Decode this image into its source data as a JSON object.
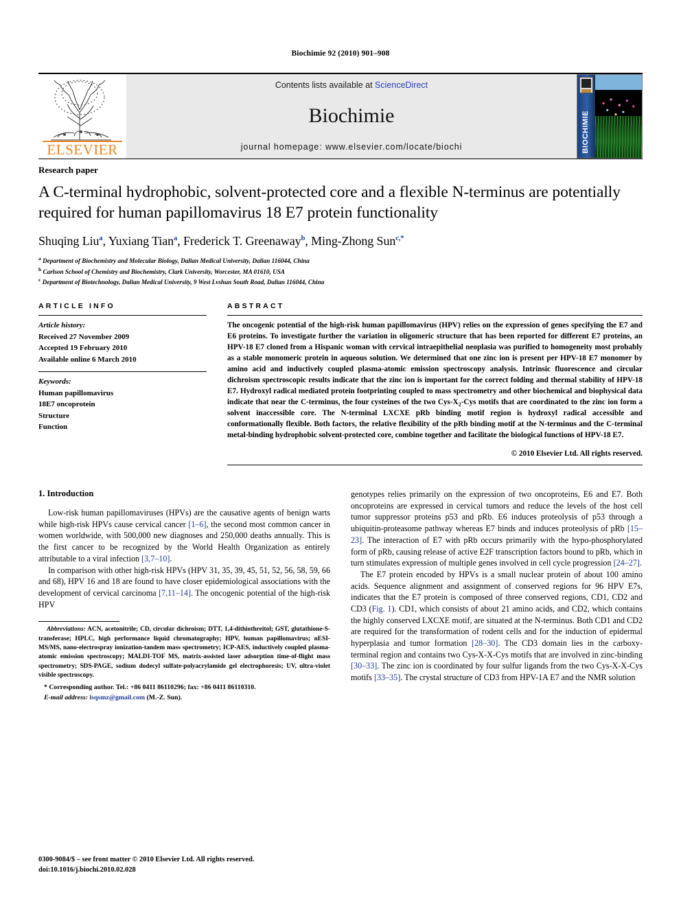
{
  "running_head": "Biochimie 92 (2010) 901–908",
  "masthead": {
    "publisher_name": "ELSEVIER",
    "contents_prefix": "Contents lists available at ",
    "contents_link": "ScienceDirect",
    "journal_title": "Biochimie",
    "homepage": "journal homepage: www.elsevier.com/locate/biochi",
    "cover_spine_text": "BIOCHIMIE",
    "link_color": "#2b3fb0",
    "brand_color": "#f0841e"
  },
  "article": {
    "paper_type": "Research paper",
    "title": "A C-terminal hydrophobic, solvent-protected core and a flexible N-terminus are potentially required for human papillomavirus 18 E7 protein functionality",
    "authors": [
      {
        "name": "Shuqing Liu",
        "sup": "a",
        "sep": ", "
      },
      {
        "name": "Yuxiang Tian",
        "sup": "a",
        "sep": ", "
      },
      {
        "name": "Frederick T. Greenaway",
        "sup": "b",
        "sep": ", "
      },
      {
        "name": "Ming-Zhong Sun",
        "sup": "c,*",
        "sep": ""
      }
    ],
    "affiliations": [
      {
        "mark": "a",
        "text": "Department of Biochemistry and Molecular Biology, Dalian Medical University, Dalian 116044, China"
      },
      {
        "mark": "b",
        "text": "Carlson School of Chemistry and Biochemistry, Clark University, Worcester, MA 01610, USA"
      },
      {
        "mark": "c",
        "text": "Department of Biotechnology, Dalian Medical University, 9 West Lvshun South Road, Dalian 116044, China"
      }
    ]
  },
  "article_info": {
    "heading": "ARTICLE INFO",
    "history_label": "Article history:",
    "history": [
      "Received 27 November 2009",
      "Accepted 19 February 2010",
      "Available online 6 March 2010"
    ],
    "keywords_label": "Keywords:",
    "keywords": [
      "Human papillomavirus",
      "18E7 oncoprotein",
      "Structure",
      "Function"
    ]
  },
  "abstract": {
    "heading": "ABSTRACT",
    "part1": "The oncogenic potential of the high-risk human papillomavirus (HPV) relies on the expression of genes specifying the E7 and E6 proteins. To investigate further the variation in oligomeric structure that has been reported for different E7 proteins, an HPV-18 E7 cloned from a Hispanic woman with cervical intraepithelial neoplasia was purified to homogeneity most probably as a stable monomeric protein in aqueous solution. We determined that one zinc ion is present per HPV-18 E7 monomer by amino acid and inductively coupled plasma-atomic emission spectroscopy analysis. Intrinsic fluorescence and circular dichroism spectroscopic results indicate that the zinc ion is important for the correct folding and thermal stability of HPV-18 E7. Hydroxyl radical mediated protein footprinting coupled to mass spectrometry and other biochemical and biophysical data indicate that near the C-terminus, the four cysteines of the two Cys-X",
    "sub1": "2",
    "part2": "-Cys motifs that are coordinated to the zinc ion form a solvent inaccessible core. The N-terminal LXCXE pRb binding motif region is hydroxyl radical accessible and conformationally flexible. Both factors, the relative flexibility of the pRb binding motif at the N-terminus and the C-terminal metal-binding hydrophobic solvent-protected core, combine together and facilitate the biological functions of HPV-18 E7.",
    "copyright": "© 2010 Elsevier Ltd. All rights reserved."
  },
  "intro": {
    "heading": "1. Introduction",
    "left": {
      "p1_a": "Low-risk human papillomaviruses (HPVs) are the causative agents of benign warts while high-risk HPVs cause cervical cancer ",
      "p1_ref1": "[1–6]",
      "p1_b": ", the second most common cancer in women worldwide, with 500,000 new diagnoses and 250,000 deaths annually. This is the first cancer to be recognized by the World Health Organization as entirely attributable to a viral infection ",
      "p1_ref2": "[3,7–10]",
      "p1_c": ".",
      "p2_a": "In comparison with other high-risk HPVs (HPV 31, 35, 39, 45, 51, 52, 56, 58, 59, 66 and 68), HPV 16 and 18 are found to have closer epidemiological associations with the development of cervical carcinoma ",
      "p2_ref1": "[7,11–14]",
      "p2_b": ". The oncogenic potential of the high-risk HPV"
    },
    "right": {
      "p1_a": "genotypes relies primarily on the expression of two oncoproteins, E6 and E7. Both oncoproteins are expressed in cervical tumors and reduce the levels of the host cell tumor suppressor proteins p53 and pRb. E6 induces proteolysis of p53 through a ubiquitin-proteasome pathway whereas E7 binds and induces proteolysis of pRb ",
      "p1_ref1": "[15–23]",
      "p1_b": ". The interaction of E7 with pRb occurs primarily with the hypo-phosphorylated form of pRb, causing release of active E2F transcription factors bound to pRb, which in turn stimulates expression of multiple genes involved in cell cycle progression ",
      "p1_ref2": "[24–27]",
      "p1_c": ".",
      "p2_a": "The E7 protein encoded by HPVs is a small nuclear protein of about 100 amino acids. Sequence alignment and assignment of conserved regions for 96 HPV E7s, indicates that the E7 protein is composed of three conserved regions, CD1, CD2 and CD3 (",
      "p2_figref": "Fig. 1",
      "p2_b": "). CD1, which consists of about 21 amino acids, and CD2, which contains the highly conserved LXCXE motif, are situated at the N-terminus. Both CD1 and CD2 are required for the transformation of rodent cells and for the induction of epidermal hyperplasia and tumor formation ",
      "p2_ref1": "[28–30]",
      "p2_c": ". The CD3 domain lies in the carboxy-terminal region and contains two Cys-X-X-Cys motifs that are involved in zinc-binding ",
      "p2_ref2": "[30–33]",
      "p2_d": ". The zinc ion is coordinated by four sulfur ligands from the two Cys-X-X-Cys motifs ",
      "p2_ref3": "[33–35]",
      "p2_e": ". The crystal structure of CD3 from HPV-1A E7 and the NMR solution"
    }
  },
  "footnotes": {
    "abbrev_label": "Abbreviations:",
    "abbrev_text": " ACN, acetonitrile; CD, circular dichroism; DTT, 1,4-dithiothreitol; GST, glutathione-S-transferase; HPLC, high performance liquid chromatography; HPV, human papillomavirus; nESI-MS/MS, nano-electrospray ionization-tandem mass spectrometry; ICP-AES, inductively coupled plasma-atomic emission spectroscopy; MALDI-TOF MS, matrix-assisted laser adsorption time-of-flight mass spectrometry; SDS-PAGE, sodium dodecyl sulfate-polyacrylamide gel electrophoresis; UV, ultra-violet visible spectroscopy.",
    "corresponding": "* Corresponding author. Tel.: +86 0411 86110296; fax: +86 0411 86110310.",
    "email_label": "E-mail address:",
    "email": "lsqsmz@gmail.com",
    "email_suffix": " (M.-Z. Sun)."
  },
  "page_footer": {
    "line1": "0300-9084/$ – see front matter © 2010 Elsevier Ltd. All rights reserved.",
    "line2": "doi:10.1016/j.biochi.2010.02.028"
  }
}
